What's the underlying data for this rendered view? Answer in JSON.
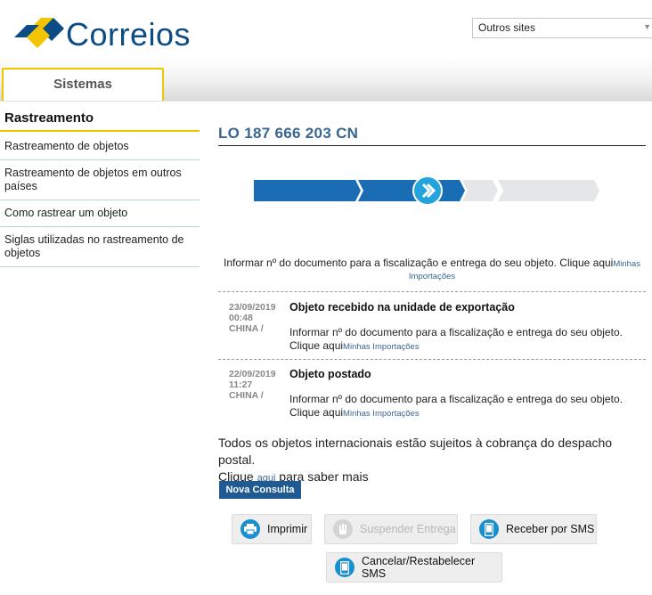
{
  "header": {
    "logo_text": "Correios",
    "sites_select_value": "Outros sites",
    "tab_label": "Sistemas"
  },
  "sidebar": {
    "title": "Rastreamento",
    "items": [
      {
        "label": "Rastreamento de objetos"
      },
      {
        "label": "Rastreamento de objetos em outros países"
      },
      {
        "label": "Como rastrear um objeto"
      },
      {
        "label": "Siglas utilizadas no rastreamento de objetos"
      }
    ]
  },
  "main": {
    "tracking_code": "LO 187 666 203 CN",
    "progress": {
      "steps_total": 4,
      "current_step": 2
    },
    "notice": {
      "text": "Informar nº do documento para a fiscalização e entrega do seu objeto. Clique aqui",
      "link": "Minhas Importações"
    },
    "events": [
      {
        "date": "23/09/2019",
        "time": "00:48",
        "location": "CHINA /",
        "title": "Objeto recebido na unidade de exportação",
        "desc": "Informar nº do documento para a fiscalização e entrega do seu objeto.",
        "click": "Clique aqui",
        "link": "Minhas Importações"
      },
      {
        "date": "22/09/2019",
        "time": "11:27",
        "location": "CHINA /",
        "title": "Objeto postado",
        "desc": "Informar nº do documento para a fiscalização e entrega do seu objeto.",
        "click": "Clique aqui",
        "link": "Minhas Importações"
      }
    ],
    "tax_info": {
      "line1": "Todos os objetos internacionais estão sujeitos à cobrança do despacho postal.",
      "prefix": "Clique",
      "link": "aqui",
      "suffix": "para saber mais"
    },
    "buttons": {
      "new_query": "Nova Consulta",
      "print": "Imprimir",
      "suspend": "Suspender Entrega",
      "sms": "Receber por SMS",
      "cancel_sms": "Cancelar/Restabelecer SMS"
    }
  },
  "colors": {
    "brand_blue": "#0b4c85",
    "brand_yellow": "#f5c400",
    "progress_blue": "#1a6db5",
    "progress_gray": "#e4e6e8",
    "link_blue": "#3a6591",
    "button_blue": "#1f5a92"
  }
}
